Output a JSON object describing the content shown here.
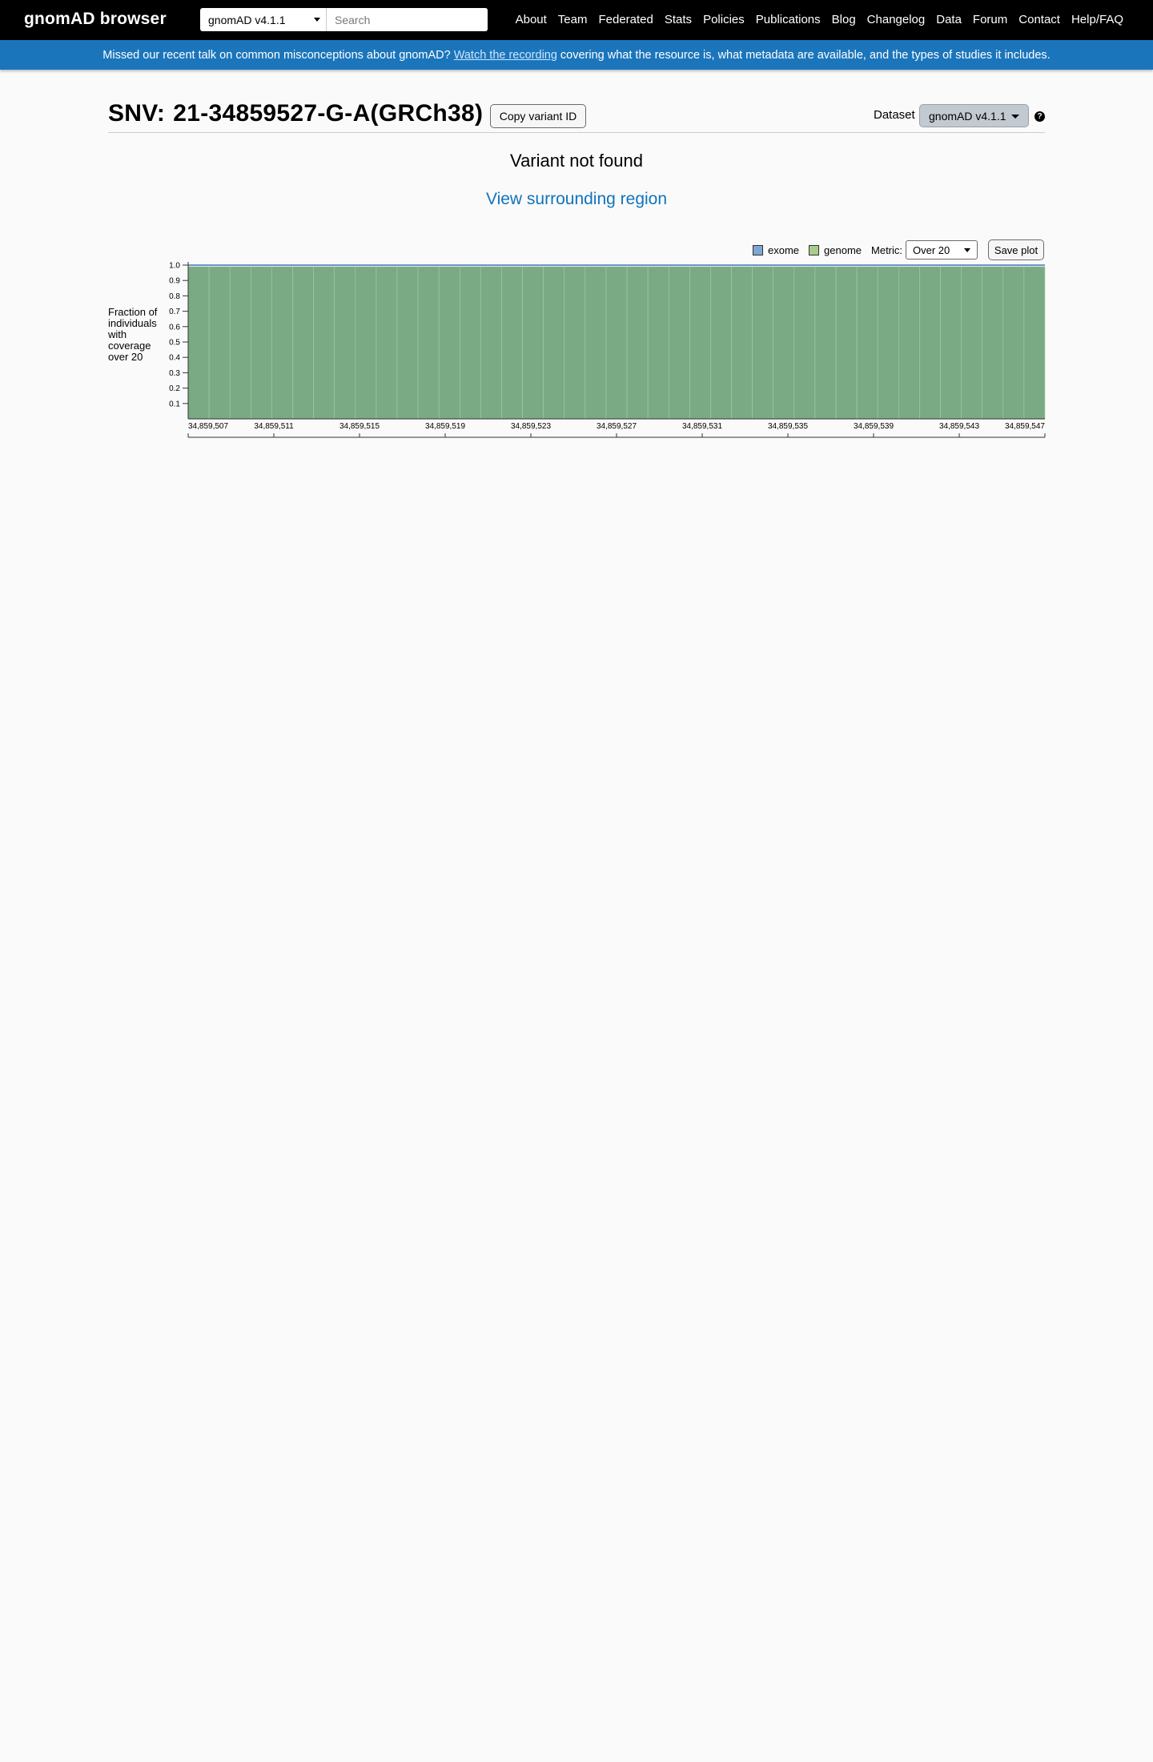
{
  "topbar": {
    "brand": "gnomAD browser",
    "dataset_selected": "gnomAD v4.1.1",
    "search_placeholder": "Search",
    "nav": [
      "About",
      "Team",
      "Federated",
      "Stats",
      "Policies",
      "Publications",
      "Blog",
      "Changelog",
      "Data",
      "Forum",
      "Contact",
      "Help/FAQ"
    ]
  },
  "announcement": {
    "before": "Missed our recent talk on common misconceptions about gnomAD?",
    "link": "Watch the recording",
    "after": "covering what the resource is, what metadata are available, and the types of studies it includes."
  },
  "header": {
    "variant_type": "SNV:",
    "variant_id": "21-34859527-G-A(GRCh38)",
    "copy_button": "Copy variant ID",
    "dataset_label": "Dataset",
    "dataset_value": "gnomAD v4.1.1",
    "help_icon": "question-circle-icon"
  },
  "main": {
    "not_found": "Variant not found",
    "surrounding_link": "View surrounding region"
  },
  "coverage": {
    "legend": [
      {
        "label": "exome",
        "color": "#428bca"
      },
      {
        "label": "genome",
        "color": "#73ab3d"
      }
    ],
    "metric_label": "Metric:",
    "metric_value": "Over 20",
    "save_button": "Save plot",
    "ylabel": "Fraction of individuals with coverage over 20"
  },
  "colors": {
    "accent": "#1b75bb",
    "link": "#1173bb",
    "genome_fill": "#7aaa84",
    "exome_line": "#6f94cf"
  },
  "chart_data": {
    "type": "area",
    "ylabel": "Fraction of individuals with coverage over 20",
    "ylim": [
      0,
      1.0
    ],
    "yticks": [
      "0.1",
      "0.2",
      "0.3",
      "0.4",
      "0.5",
      "0.6",
      "0.7",
      "0.8",
      "0.9",
      "1.0"
    ],
    "xlim": [
      34859507,
      34859547
    ],
    "xticks": [
      "34,859,507",
      "34,859,511",
      "34,859,515",
      "34,859,519",
      "34,859,523",
      "34,859,527",
      "34,859,531",
      "34,859,535",
      "34,859,539",
      "34,859,543",
      "34,859,547"
    ],
    "series": [
      {
        "name": "exome",
        "values": [
          1.0,
          1.0,
          1.0,
          1.0,
          1.0,
          1.0,
          1.0,
          1.0,
          1.0,
          1.0,
          1.0,
          1.0,
          1.0,
          1.0,
          1.0,
          1.0,
          1.0,
          1.0,
          1.0,
          1.0,
          1.0,
          1.0,
          1.0,
          1.0,
          1.0,
          1.0,
          1.0,
          1.0,
          1.0,
          1.0,
          1.0,
          1.0,
          1.0,
          1.0,
          1.0,
          1.0,
          1.0,
          1.0,
          1.0,
          1.0,
          1.0
        ]
      },
      {
        "name": "genome",
        "values": [
          0.99,
          0.99,
          0.99,
          0.99,
          0.99,
          0.99,
          0.99,
          0.99,
          0.99,
          0.99,
          0.99,
          0.99,
          0.99,
          0.99,
          0.99,
          0.99,
          0.99,
          0.99,
          0.99,
          0.99,
          0.99,
          0.99,
          0.99,
          0.99,
          0.99,
          0.99,
          0.99,
          0.99,
          0.99,
          0.99,
          0.99,
          0.99,
          0.99,
          0.99,
          0.99,
          0.99,
          0.99,
          0.99,
          0.99,
          0.99,
          0.99
        ]
      }
    ]
  }
}
